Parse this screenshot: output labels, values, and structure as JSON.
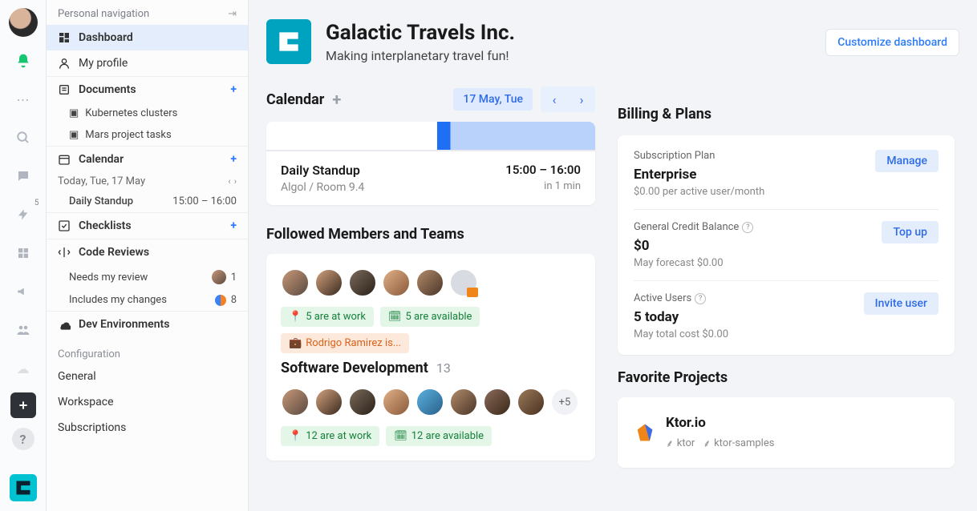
{
  "sidebar": {
    "header": "Personal navigation",
    "dashboard": "Dashboard",
    "profile": "My profile",
    "documents": "Documents",
    "doc_items": [
      "Kubernetes clusters",
      "Mars project tasks"
    ],
    "calendar": "Calendar",
    "today": "Today, Tue, 17 May",
    "daily_standup": "Daily Standup",
    "daily_time": "15:00 – 16:00",
    "checklists": "Checklists",
    "code_reviews": "Code Reviews",
    "needs_review": "Needs my review",
    "needs_review_count": "1",
    "includes_changes": "Includes my changes",
    "includes_changes_count": "8",
    "dev_env": "Dev Environments",
    "config_title": "Configuration",
    "config_items": [
      "General",
      "Workspace",
      "Subscriptions"
    ]
  },
  "rail": {
    "lightning_badge": "5"
  },
  "header": {
    "title": "Galactic Travels Inc.",
    "subtitle": "Making interplanetary travel fun!",
    "customize": "Customize dashboard"
  },
  "calendar": {
    "title": "Calendar",
    "date": "17 May, Tue",
    "event_name": "Daily Standup",
    "event_loc": "Algol / Room 9.4",
    "event_time": "15:00 – 16:00",
    "event_rel": "in 1 min"
  },
  "followed": {
    "title": "Followed Members and Teams",
    "chip_work": "5 are at work",
    "chip_avail": "5 are available",
    "chip_person": "Rodrigo Ramirez is...",
    "team2_name": "Software Development",
    "team2_count": "13",
    "team2_more": "+5",
    "team2_work": "12 are at work",
    "team2_avail": "12 are available"
  },
  "billing": {
    "title": "Billing & Plans",
    "plan_label": "Subscription Plan",
    "plan_value": "Enterprise",
    "plan_sub": "$0.00 per active user/month",
    "manage": "Manage",
    "credit_label": "General Credit Balance",
    "credit_value": "$0",
    "credit_sub": "May forecast $0.00",
    "topup": "Top up",
    "users_label": "Active Users",
    "users_value": "5 today",
    "users_sub": "May total cost $0.00",
    "invite": "Invite user"
  },
  "favorites": {
    "title": "Favorite Projects",
    "p1_name": "Ktor.io",
    "p1_tags": [
      "ktor",
      "ktor-samples"
    ]
  }
}
